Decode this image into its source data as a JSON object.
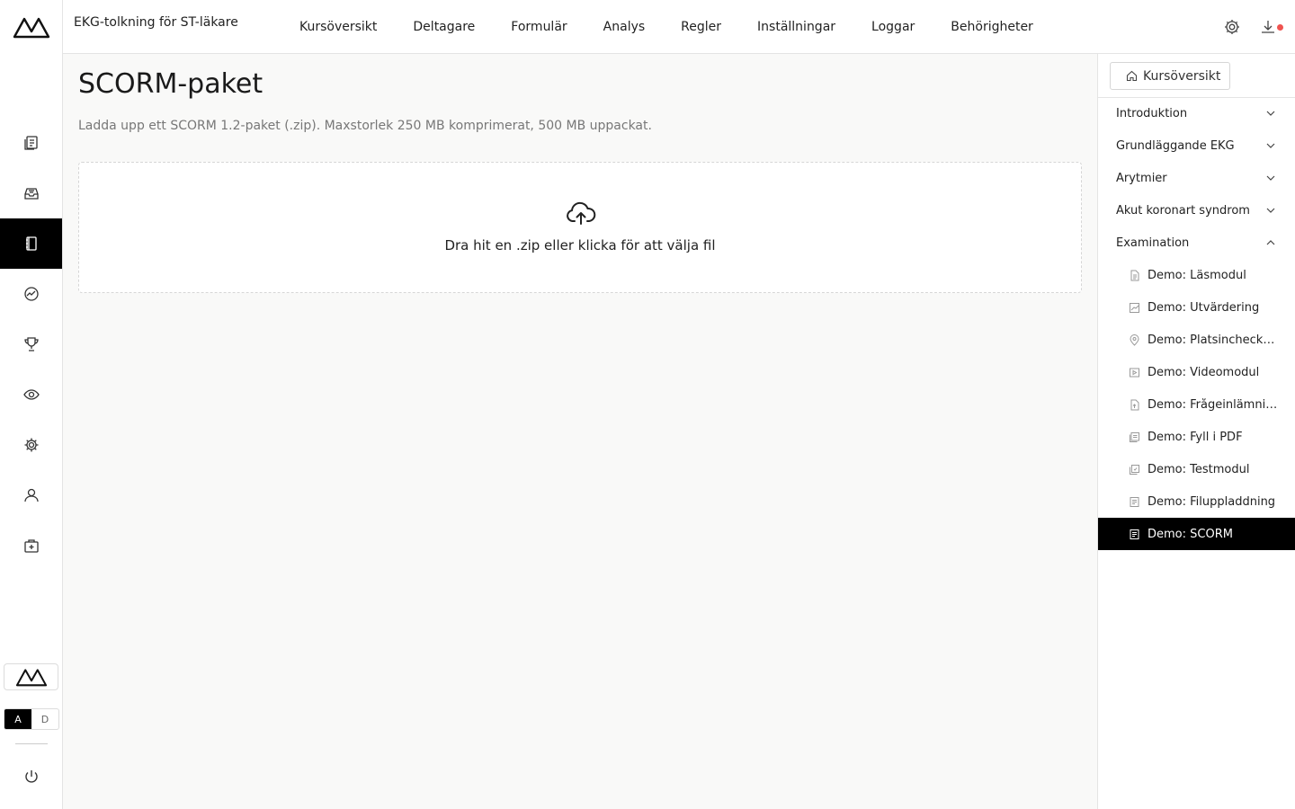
{
  "app": {
    "course_title": "EKG-tolkning för ST-läkare"
  },
  "topnav": {
    "items": [
      "Kursöversikt",
      "Deltagare",
      "Formulär",
      "Analys",
      "Regler",
      "Inställningar",
      "Loggar",
      "Behörigheter"
    ]
  },
  "rail": {
    "items": [
      {
        "icon": "documents-icon",
        "active": false
      },
      {
        "icon": "inbox-icon",
        "active": false
      },
      {
        "icon": "notebook-icon",
        "active": true
      },
      {
        "icon": "analytics-icon",
        "active": false
      },
      {
        "icon": "trophy-icon",
        "active": false
      },
      {
        "icon": "eye-icon",
        "active": false
      },
      {
        "icon": "gear-icon",
        "active": false
      },
      {
        "icon": "user-icon",
        "active": false
      },
      {
        "icon": "medical-kit-icon",
        "active": false
      }
    ],
    "lang": {
      "a": "A",
      "d": "D"
    }
  },
  "main": {
    "title": "SCORM-paket",
    "description": "Ladda upp ett SCORM 1.2-paket (.zip). Maxstorlek 250 MB komprimerat, 500 MB uppackat.",
    "dropzone_text": "Dra hit en .zip eller klicka för att välja fil"
  },
  "right_panel": {
    "overview_button": "Kursöversikt",
    "sections": [
      {
        "label": "Introduktion",
        "expanded": false
      },
      {
        "label": "Grundläggande EKG",
        "expanded": false
      },
      {
        "label": "Arytmier",
        "expanded": false
      },
      {
        "label": "Akut koronart syndrom",
        "expanded": false
      },
      {
        "label": "Examination",
        "expanded": true
      }
    ],
    "lessons": [
      {
        "label": "Demo: Läsmodul",
        "icon": "document-icon"
      },
      {
        "label": "Demo: Utvärdering",
        "icon": "evaluation-icon"
      },
      {
        "label": "Demo: Platsincheckning",
        "icon": "location-pin-icon"
      },
      {
        "label": "Demo: Videomodul",
        "icon": "video-icon"
      },
      {
        "label": "Demo: Frågeinlämning",
        "icon": "file-upload-icon"
      },
      {
        "label": "Demo: Fyll i PDF",
        "icon": "pdf-icon"
      },
      {
        "label": "Demo: Testmodul",
        "icon": "test-icon"
      },
      {
        "label": "Demo: Filuppladdning",
        "icon": "file-icon"
      },
      {
        "label": "Demo: SCORM",
        "icon": "scorm-icon",
        "active": true
      }
    ]
  }
}
